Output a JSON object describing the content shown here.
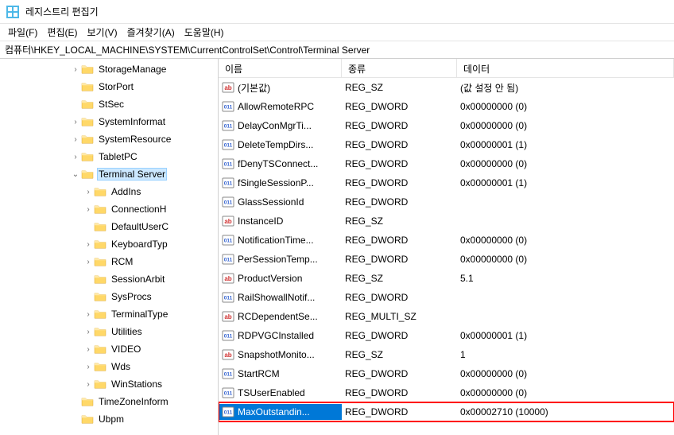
{
  "window": {
    "title": "레지스트리 편집기"
  },
  "menu": {
    "file": "파일(F)",
    "edit": "편집(E)",
    "view": "보기(V)",
    "favorites": "즐겨찾기(A)",
    "help": "도움말(H)"
  },
  "address": "컴퓨터\\HKEY_LOCAL_MACHINE\\SYSTEM\\CurrentControlSet\\Control\\Terminal Server",
  "tree": [
    {
      "label": "StorageManage",
      "depth": 5,
      "expander": ">",
      "hasChildren": true
    },
    {
      "label": "StorPort",
      "depth": 5,
      "expander": "",
      "hasChildren": false
    },
    {
      "label": "StSec",
      "depth": 5,
      "expander": "",
      "hasChildren": false
    },
    {
      "label": "SystemInformat",
      "depth": 5,
      "expander": ">",
      "hasChildren": true
    },
    {
      "label": "SystemResource",
      "depth": 5,
      "expander": ">",
      "hasChildren": true
    },
    {
      "label": "TabletPC",
      "depth": 5,
      "expander": ">",
      "hasChildren": true
    },
    {
      "label": "Terminal Server",
      "depth": 5,
      "expander": "v",
      "hasChildren": true,
      "selected": true
    },
    {
      "label": "AddIns",
      "depth": 6,
      "expander": ">",
      "hasChildren": true
    },
    {
      "label": "ConnectionH",
      "depth": 6,
      "expander": ">",
      "hasChildren": true
    },
    {
      "label": "DefaultUserC",
      "depth": 6,
      "expander": "",
      "hasChildren": false
    },
    {
      "label": "KeyboardTyp",
      "depth": 6,
      "expander": ">",
      "hasChildren": true
    },
    {
      "label": "RCM",
      "depth": 6,
      "expander": ">",
      "hasChildren": true
    },
    {
      "label": "SessionArbit",
      "depth": 6,
      "expander": "",
      "hasChildren": false
    },
    {
      "label": "SysProcs",
      "depth": 6,
      "expander": "",
      "hasChildren": false
    },
    {
      "label": "TerminalType",
      "depth": 6,
      "expander": ">",
      "hasChildren": true
    },
    {
      "label": "Utilities",
      "depth": 6,
      "expander": ">",
      "hasChildren": true
    },
    {
      "label": "VIDEO",
      "depth": 6,
      "expander": ">",
      "hasChildren": true
    },
    {
      "label": "Wds",
      "depth": 6,
      "expander": ">",
      "hasChildren": true
    },
    {
      "label": "WinStations",
      "depth": 6,
      "expander": ">",
      "hasChildren": true
    },
    {
      "label": "TimeZoneInform",
      "depth": 5,
      "expander": "",
      "hasChildren": false
    },
    {
      "label": "Ubpm",
      "depth": 5,
      "expander": "",
      "hasChildren": false
    }
  ],
  "columns": {
    "name": "이름",
    "type": "종류",
    "data": "데이터"
  },
  "values": [
    {
      "name": "(기본값)",
      "type": "REG_SZ",
      "data": "(값 설정 안 됨)",
      "iconType": "sz"
    },
    {
      "name": "AllowRemoteRPC",
      "type": "REG_DWORD",
      "data": "0x00000000 (0)",
      "iconType": "dw"
    },
    {
      "name": "DelayConMgrTi...",
      "type": "REG_DWORD",
      "data": "0x00000000 (0)",
      "iconType": "dw"
    },
    {
      "name": "DeleteTempDirs...",
      "type": "REG_DWORD",
      "data": "0x00000001 (1)",
      "iconType": "dw"
    },
    {
      "name": "fDenyTSConnect...",
      "type": "REG_DWORD",
      "data": "0x00000000 (0)",
      "iconType": "dw"
    },
    {
      "name": "fSingleSessionP...",
      "type": "REG_DWORD",
      "data": "0x00000001 (1)",
      "iconType": "dw"
    },
    {
      "name": "GlassSessionId",
      "type": "REG_DWORD",
      "data": "",
      "iconType": "dw"
    },
    {
      "name": "InstanceID",
      "type": "REG_SZ",
      "data": "",
      "iconType": "sz"
    },
    {
      "name": "NotificationTime...",
      "type": "REG_DWORD",
      "data": "0x00000000 (0)",
      "iconType": "dw"
    },
    {
      "name": "PerSessionTemp...",
      "type": "REG_DWORD",
      "data": "0x00000000 (0)",
      "iconType": "dw"
    },
    {
      "name": "ProductVersion",
      "type": "REG_SZ",
      "data": "5.1",
      "iconType": "sz"
    },
    {
      "name": "RailShowallNotif...",
      "type": "REG_DWORD",
      "data": "",
      "iconType": "dw"
    },
    {
      "name": "RCDependentSe...",
      "type": "REG_MULTI_SZ",
      "data": "",
      "iconType": "sz"
    },
    {
      "name": "RDPVGCInstalled",
      "type": "REG_DWORD",
      "data": "0x00000001 (1)",
      "iconType": "dw"
    },
    {
      "name": "SnapshotMonito...",
      "type": "REG_SZ",
      "data": "1",
      "iconType": "sz"
    },
    {
      "name": "StartRCM",
      "type": "REG_DWORD",
      "data": "0x00000000 (0)",
      "iconType": "dw"
    },
    {
      "name": "TSUserEnabled",
      "type": "REG_DWORD",
      "data": "0x00000000 (0)",
      "iconType": "dw"
    },
    {
      "name": "MaxOutstandin...",
      "type": "REG_DWORD",
      "data": "0x00002710 (10000)",
      "iconType": "dw",
      "highlighted": true,
      "selected": true
    }
  ]
}
